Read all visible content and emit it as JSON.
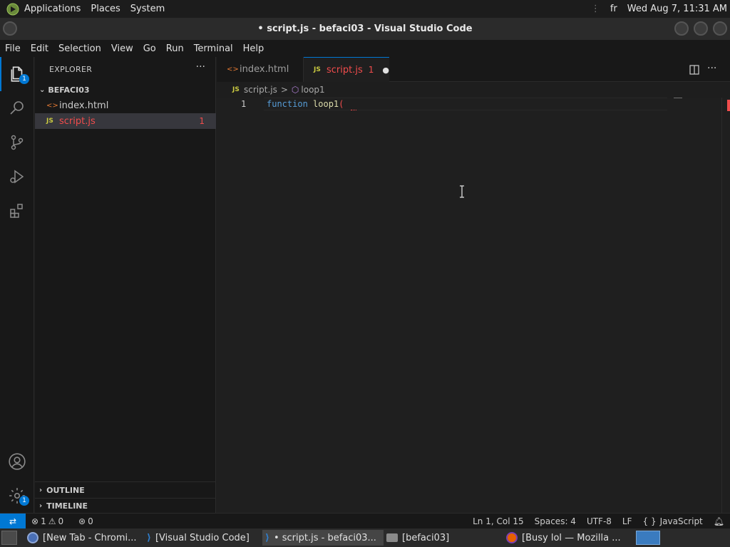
{
  "panel": {
    "menus": [
      "Applications",
      "Places",
      "System"
    ],
    "keyboard": "fr",
    "clock": "Wed Aug  7, 11:31 AM"
  },
  "window": {
    "title": "• script.js - befaci03 - Visual Studio Code"
  },
  "menubar": [
    "File",
    "Edit",
    "Selection",
    "View",
    "Go",
    "Run",
    "Terminal",
    "Help"
  ],
  "activity": {
    "explorer_badge": "1",
    "accounts_badge": "1"
  },
  "sidebar": {
    "title": "EXPLORER",
    "more": "···",
    "folder": "BEFACI03",
    "files": [
      {
        "icon": "<>",
        "name": "index.html"
      },
      {
        "icon": "JS",
        "name": "script.js",
        "problems": "1"
      }
    ],
    "outline": "OUTLINE",
    "timeline": "TIMELINE"
  },
  "tabs": [
    {
      "icon": "<>",
      "name": "index.html"
    },
    {
      "icon": "JS",
      "name": "script.js",
      "problems": "1",
      "dirty": "●"
    }
  ],
  "breadcrumb": {
    "file_icon": "JS",
    "file": "script.js",
    "separator": ">",
    "symbol": "loop1"
  },
  "editor": {
    "line_number": "1",
    "keyword": "function",
    "identifier": "loop1",
    "paren": "("
  },
  "status": {
    "errors": "1",
    "warnings": "0",
    "ports": "0",
    "position": "Ln 1, Col 15",
    "spaces": "Spaces: 4",
    "encoding": "UTF-8",
    "eol": "LF",
    "language_brace": "{ }",
    "language": "JavaScript"
  },
  "taskbar": [
    {
      "label": "[New Tab - Chromi..."
    },
    {
      "label": "[Visual Studio Code]"
    },
    {
      "label": "• script.js - befaci03..."
    },
    {
      "label": "[befaci03]"
    },
    {
      "label": "[Busy lol — Mozilla ..."
    }
  ],
  "colors": {
    "accent": "#0078d4",
    "js_icon": "#cbcb41",
    "html_icon": "#e37933",
    "error": "#f14c4c",
    "keyword": "#569cd6"
  }
}
